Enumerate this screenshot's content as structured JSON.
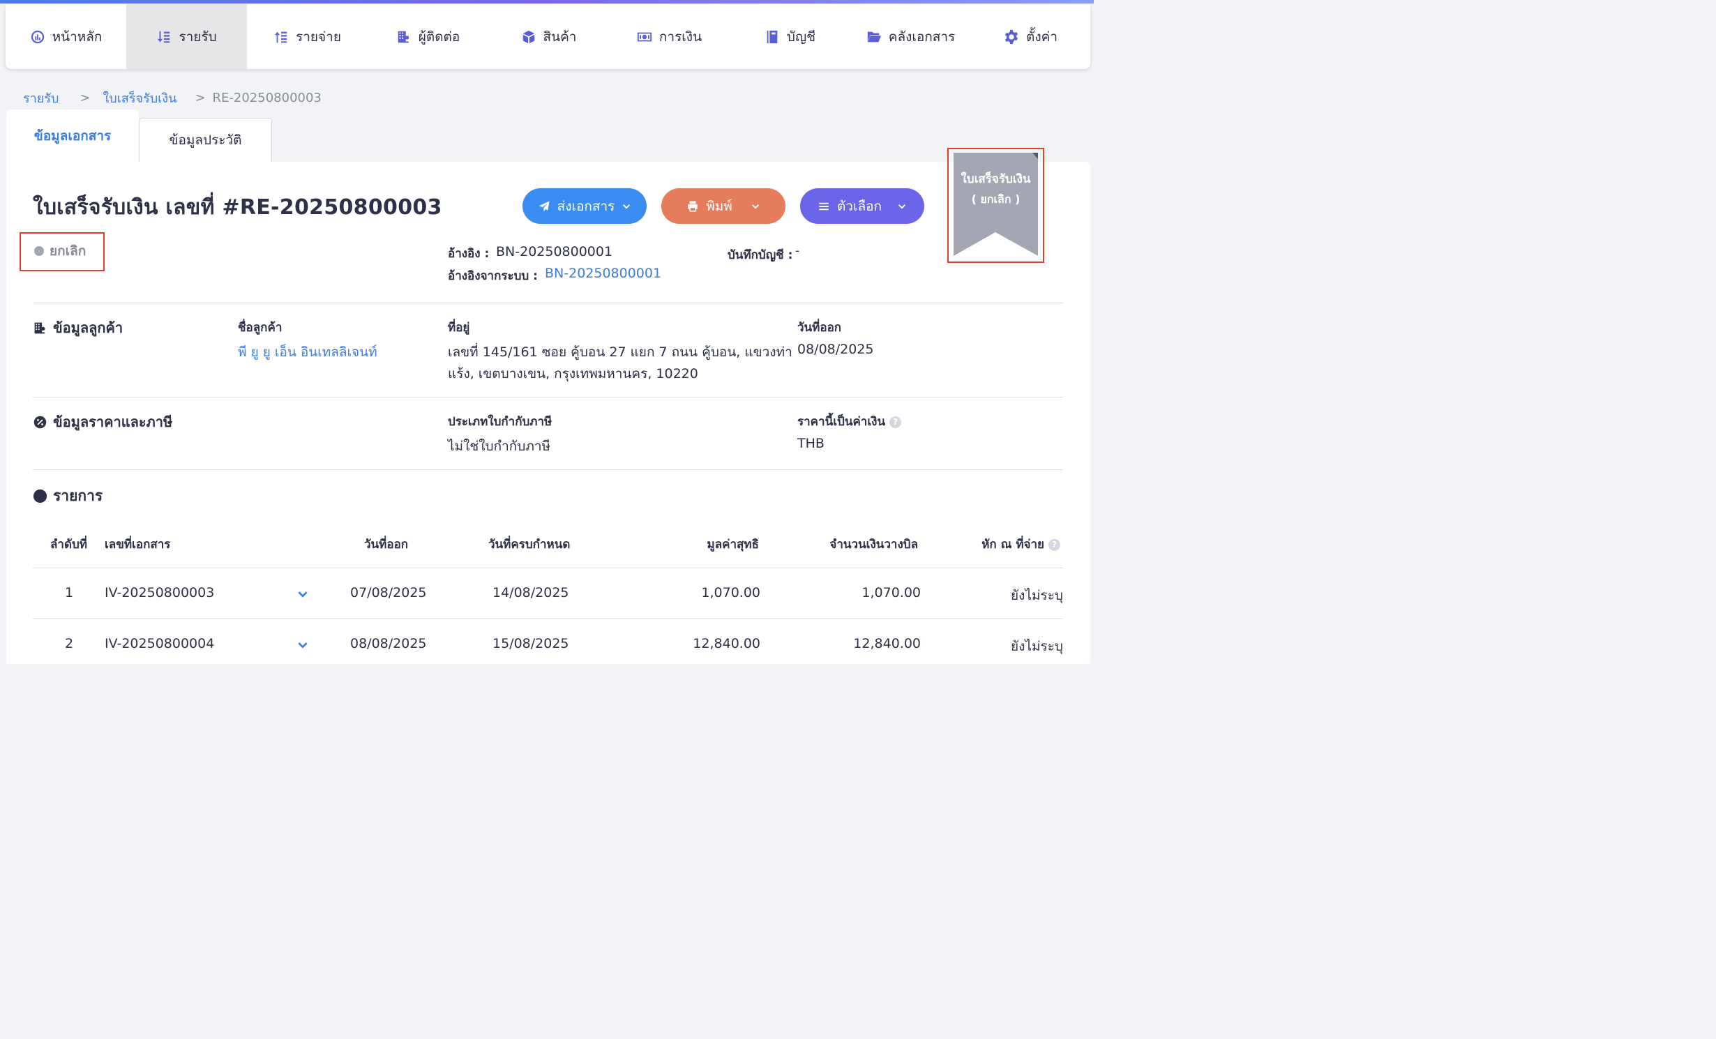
{
  "nav": {
    "items": [
      {
        "label": "หน้าหลัก",
        "icon": "dashboard-gauge-icon"
      },
      {
        "label": "รายรับ",
        "icon": "income-sort-icon"
      },
      {
        "label": "รายจ่าย",
        "icon": "expense-sort-icon"
      },
      {
        "label": "ผู้ติดต่อ",
        "icon": "contacts-building-icon"
      },
      {
        "label": "สินค้า",
        "icon": "product-box-icon"
      },
      {
        "label": "การเงิน",
        "icon": "money-bill-icon"
      },
      {
        "label": "บัญชี",
        "icon": "ledger-book-icon"
      },
      {
        "label": "คลังเอกสาร",
        "icon": "folder-open-icon"
      },
      {
        "label": "ตั้งค่า",
        "icon": "gear-icon"
      }
    ],
    "active_index": 1
  },
  "breadcrumb": {
    "level1": "รายรับ",
    "level2": "ใบเสร็จรับเงิน",
    "current": "RE-20250800003",
    "separator": ">"
  },
  "tabs": {
    "document_info": "ข้อมูลเอกสาร",
    "history": "ข้อมูลประวัติ"
  },
  "document": {
    "title": "ใบเสร็จรับเงิน เลขที่ #RE-20250800003",
    "status": "ยกเลิก",
    "ribbon_line1": "ใบเสร็จรับเงิน",
    "ribbon_line2": "( ยกเลิก )",
    "reference_label": "อ้างอิง :",
    "reference_value": "BN-20250800001",
    "system_reference_label": "อ้างอิงจากระบบ :",
    "system_reference_value": "BN-20250800001",
    "accounting_label": "บันทึกบัญชี :",
    "accounting_value": "-"
  },
  "actions": {
    "send": "ส่งเอกสาร",
    "print": "พิมพ์",
    "options": "ตัวเลือก"
  },
  "customer": {
    "section_title": "ข้อมูลลูกค้า",
    "name_label": "ชื่อลูกค้า",
    "name_value": "พี ยู ยู เอ็น อินเทลลิเจนท์",
    "address_label": "ที่อยู่",
    "address_line1": "เลขที่ 145/161 ซอย คู้บอน 27 แยก 7 ถนน คู้บอน, แขวงท่า",
    "address_line2": "แร้ง, เขตบางเขน, กรุงเทพมหานคร, 10220",
    "issue_date_label": "วันที่ออก",
    "issue_date_value": "08/08/2025"
  },
  "pricing": {
    "section_title": "ข้อมูลราคาและภาษี",
    "tax_type_label": "ประเภทใบกำกับภาษี",
    "tax_type_value": "ไม่ใช่ใบกำกับภาษี",
    "currency_label": "ราคานี้เป็นค่าเงิน",
    "currency_value": "THB"
  },
  "items": {
    "section_title": "รายการ",
    "columns": [
      "ลำดับที่",
      "เลขที่เอกสาร",
      "วันที่ออก",
      "วันที่ครบกำหนด",
      "มูลค่าสุทธิ",
      "จำนวนเงินวางบิล",
      "หัก ณ ที่จ่าย"
    ],
    "rows": [
      {
        "no": "1",
        "doc": "IV-20250800003",
        "issue": "07/08/2025",
        "due": "14/08/2025",
        "net": "1,070.00",
        "billed": "1,070.00",
        "wht": "ยังไม่ระบุ"
      },
      {
        "no": "2",
        "doc": "IV-20250800004",
        "issue": "08/08/2025",
        "due": "15/08/2025",
        "net": "12,840.00",
        "billed": "12,840.00",
        "wht": "ยังไม่ระบุ"
      }
    ]
  },
  "colors": {
    "accent_blue": "#3b7de0",
    "send_button": "#3b8cf0",
    "print_button": "#e57d5d",
    "options_button": "#6b63e8",
    "ribbon": "#a4a6b3",
    "highlight_border": "#e0402a"
  }
}
